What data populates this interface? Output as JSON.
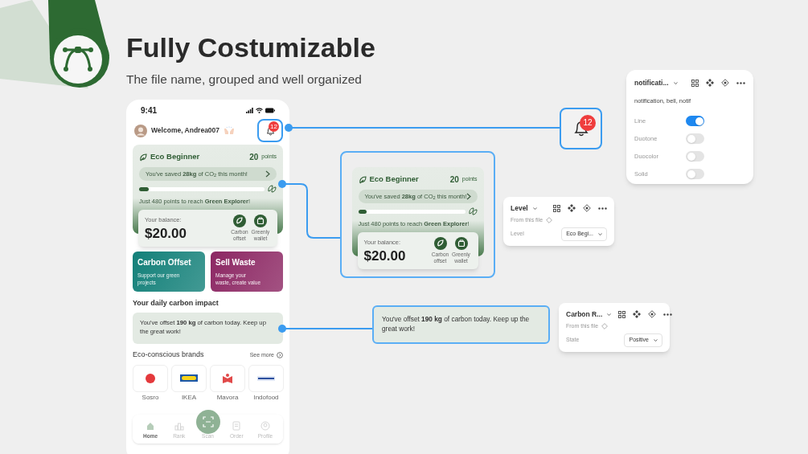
{
  "header": {
    "title": "Fully Costumizable",
    "subtitle": "The file name, grouped and well organized"
  },
  "phone": {
    "time": "9:41",
    "greeting": "Welcome, Andrea007",
    "notification_count": "12",
    "eco_card": {
      "level_name": "Eco Beginner",
      "points": "20",
      "points_unit": "points",
      "saved": "You've saved **28kg** of CO$_{2}$ this month!",
      "progress": {
        "level": 0.08
      },
      "next": "Just 480 points to reach **Green Explorer**!",
      "balance_label": "Your balance:",
      "balance": "$20.00",
      "actions": [
        {
          "label": "Carbon offset"
        },
        {
          "label": "Greenly wallet"
        }
      ]
    },
    "promo_cards": [
      {
        "title": "Carbon Offset",
        "text": "Support our green projects",
        "color": "#138079"
      },
      {
        "title": "Sell Waste",
        "text": "Manage your waste, create value",
        "color": "#8c2763"
      }
    ],
    "impact_title": "Your daily carbon impact",
    "impact_text": "You've offset **190 kg** of carbon today. Keep up the great work!",
    "brands_title": "Eco-conscious brands",
    "see_more": "See more",
    "brands": [
      {
        "name": "Sosro"
      },
      {
        "name": "IKEA"
      },
      {
        "name": "Mavora"
      },
      {
        "name": "Indofood"
      }
    ],
    "nav": [
      {
        "kind": "tab",
        "label": "Home",
        "selected": true
      },
      {
        "kind": "tab",
        "label": "Rank",
        "selected": false
      },
      {
        "kind": "scan",
        "label": "Scan",
        "selected": false
      },
      {
        "kind": "tab",
        "label": "Order",
        "selected": false
      },
      {
        "kind": "tab",
        "label": "Profile",
        "selected": false
      }
    ]
  },
  "eco_component": {
    "level_name": "Eco Beginner",
    "points": "20",
    "points_unit": "points",
    "saved": "You've saved **28kg** of CO$_{2}$ this month!",
    "progress": {
      "level": 0.08
    },
    "next": "Just 480 points to reach **Green Explorer**!",
    "balance_label": "Your balance:",
    "balance": "$20.00",
    "actions": [
      {
        "label": "Carbon offset"
      },
      {
        "label": "Greenly wallet"
      }
    ]
  },
  "bell_component": {
    "count": "12"
  },
  "notification_panel": {
    "name": "notificati...",
    "tags": "notification, bell, notif",
    "variants": [
      {
        "label": "Line",
        "on": true
      },
      {
        "label": "Duotone",
        "on": false
      },
      {
        "label": "Duocolor",
        "on": false
      },
      {
        "label": "Solid",
        "on": false
      }
    ]
  },
  "level_panel": {
    "name": "Level",
    "source": "From this file",
    "property": "Level",
    "value": "Eco Begi..."
  },
  "impact_component": {
    "text": "You've offset **190 kg** of carbon today. Keep up the great work!"
  },
  "carbon_panel": {
    "name": "Carbon R...",
    "source": "From this file",
    "property": "State",
    "value": "Positive"
  }
}
